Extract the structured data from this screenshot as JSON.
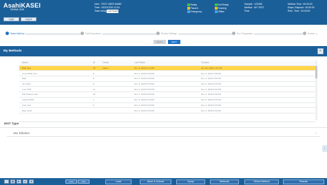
{
  "header": {
    "brand": "AsahiKASEI",
    "brand_sub": "REIWA ONE",
    "buttons": [
      "Login",
      "Logout"
    ],
    "info_col1": [
      "User : TEST USER NAME",
      "Time : 2022/12/29 12:00",
      "Team string"
    ],
    "info_col1_field": "Lab Health",
    "indicators_a": [
      "Ready",
      "Paused",
      "Emergency"
    ],
    "indicators_b": [
      "Not Ready",
      "Running",
      "Offline"
    ],
    "info_col3": [
      "Sample : 123456",
      "Method : MY TEST",
      "Flow"
    ],
    "info_col4": [
      "Method Time : 00:00:00",
      "Elaps. Elapsed : 00:00:00",
      "Rem. Time : 00:00:00"
    ],
    "colors": {
      "bar": "#1b5f98",
      "accent": "#1f73c6",
      "selected_row": "#ffd54a"
    }
  },
  "steps": [
    {
      "label": "Select Method",
      "active": true
    },
    {
      "label": "Edit Parameters",
      "active": false
    },
    {
      "label": "Review Settings",
      "active": false
    },
    {
      "label": "Run Preparation",
      "active": false
    },
    {
      "label": "Review",
      "active": false
    }
  ],
  "nav": {
    "back": "BACK",
    "next": "NEXT"
  },
  "methods": {
    "title": "My Methods",
    "columns": [
      "Name",
      "ID",
      "Owner",
      "Last Edited",
      "Created"
    ],
    "rows": [
      {
        "name": "Blah Test",
        "id": "45",
        "user": "admin",
        "last": "Nov 3, 2020 4:27 PM",
        "created": "Jan 28, 2020 3:15 PM",
        "selected": true
      },
      {
        "name": "Cross Blah Test",
        "id": "8",
        "user": "",
        "last": "Nov 3, 2020 5:03 PM",
        "created": "Nov 3, 2020 4:58 PM",
        "selected": false
      },
      {
        "name": "Blah",
        "id": "8",
        "user": "",
        "last": "Nov 3, 2020 5:03 PM",
        "created": "Nov 3, 2020 4:53 PM",
        "selected": false
      },
      {
        "name": "Jet Stack",
        "id": "8",
        "user": "",
        "last": "Nov 3, 2020 5:03 PM",
        "created": "Nov 3, 2020 5:03 PM",
        "selected": false
      },
      {
        "name": "Low TTIN",
        "id": "11",
        "user": "",
        "last": "Nov 3, 2020 5:03 PM",
        "created": "Nov 3, 2020 5:03 PM",
        "selected": false
      },
      {
        "name": "PID Plateau Test",
        "id": "25",
        "user": "",
        "last": "Nov 3, 2020 5:03 PM",
        "created": "Nov 3, 2020 4:56 PM",
        "selected": false
      },
      {
        "name": "Catwurst/PD",
        "id": "1",
        "user": "",
        "last": "Nov 3, 2020 5:03 PM",
        "created": "Nov 3, 2020 5:03 PM",
        "selected": false
      },
      {
        "name": "Cate Test",
        "id": "5",
        "user": "",
        "last": "Nov 3, 2020 5:03 PM",
        "created": "Nov 3, 2020 5:03 PM",
        "selected": false
      },
      {
        "name": "Elite Test2",
        "id": "",
        "user": "",
        "last": "Nov 3, 2020 5:03 PM",
        "created": "Nov 3, 2020 5:03 PM",
        "selected": false
      }
    ]
  },
  "material": {
    "label": "MAT Type",
    "value": "15x Dilution"
  },
  "footer": {
    "icons": [
      "home-icon",
      "grid-icon",
      "play-icon",
      "skip-icon",
      "stop-icon"
    ],
    "pills": [
      "Cost",
      "Tune"
    ],
    "buttons": [
      "Load",
      "Abort & Unload",
      "Spray",
      "Methods",
      "Select Method",
      "Results"
    ]
  }
}
